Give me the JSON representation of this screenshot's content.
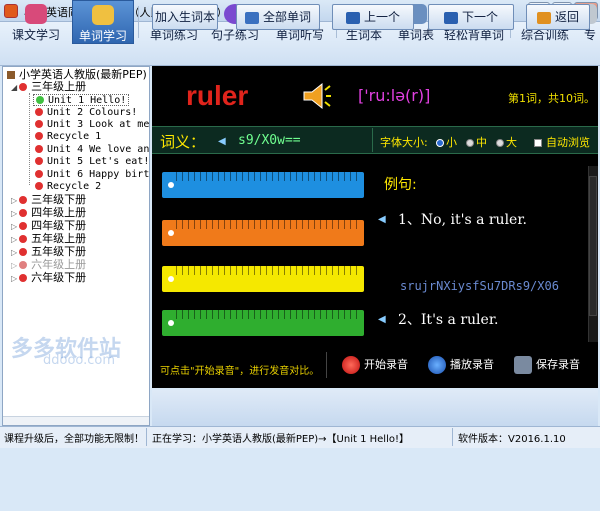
{
  "window": {
    "title": "小学英语同步课堂___（人民教育出版社）",
    "minimize": "—",
    "maximize": "□",
    "close": "✕"
  },
  "toolbar": [
    "课文学习",
    "单词学习",
    "单词练习",
    "句子练习",
    "单词听写",
    "生词本",
    "单词表",
    "轻松背单词",
    "综合训练",
    "专"
  ],
  "toolbar_active": "单词学习",
  "tree": {
    "root": "小学英语人教版(最新PEP)",
    "grade_open": "三年级上册",
    "lessons": [
      "Unit 1 Hello!",
      "Unit 2 Colours!",
      "Unit 3 Look at me!",
      "Recycle 1",
      "Unit 4 We love ani",
      "Unit 5 Let's eat!",
      "Unit 6 Happy birth",
      "Recycle 2"
    ],
    "grades_closed": [
      "三年级下册",
      "四年级上册",
      "四年级下册",
      "五年级上册",
      "五年级下册",
      "六年级上册",
      "六年级下册"
    ]
  },
  "word": {
    "text": "ruler",
    "phonetic": "['ru:lə(r)]",
    "count": "第1词，共10词。"
  },
  "meaning": {
    "label": "词义：",
    "value": "s9/X0w=="
  },
  "font": {
    "label": "字体大小:",
    "options": [
      "小",
      "中",
      "大"
    ],
    "selected": "小",
    "autobrowse": "自动浏览"
  },
  "examples": {
    "title": "例句:",
    "ex1": "1、No, it's a ruler.",
    "ghost": "srujrNXiysfSu7DRs9/X06",
    "ex2": "2、It's a ruler."
  },
  "ruler_colors": [
    "#1e8fe0",
    "#f07a1a",
    "#f5e800",
    "#2fae2f"
  ],
  "record": {
    "hint": "可点击\"开始录音\"，进行发音对比。",
    "start": "开始录音",
    "play": "播放录音",
    "save": "保存录音"
  },
  "buttons": {
    "add": "加入生词本",
    "all": "全部单词",
    "prev": "上一个",
    "next": "下一个",
    "back": "返回"
  },
  "status": {
    "upgrade": "课程升级后，全部功能无限制！",
    "learning": "正在学习：小学英语人教版(最新PEP)→【Unit 1 Hello!】",
    "version": "软件版本：V2016.1.10"
  },
  "watermark": {
    "cn": "多多软件站",
    "url": "ddooo.com"
  }
}
